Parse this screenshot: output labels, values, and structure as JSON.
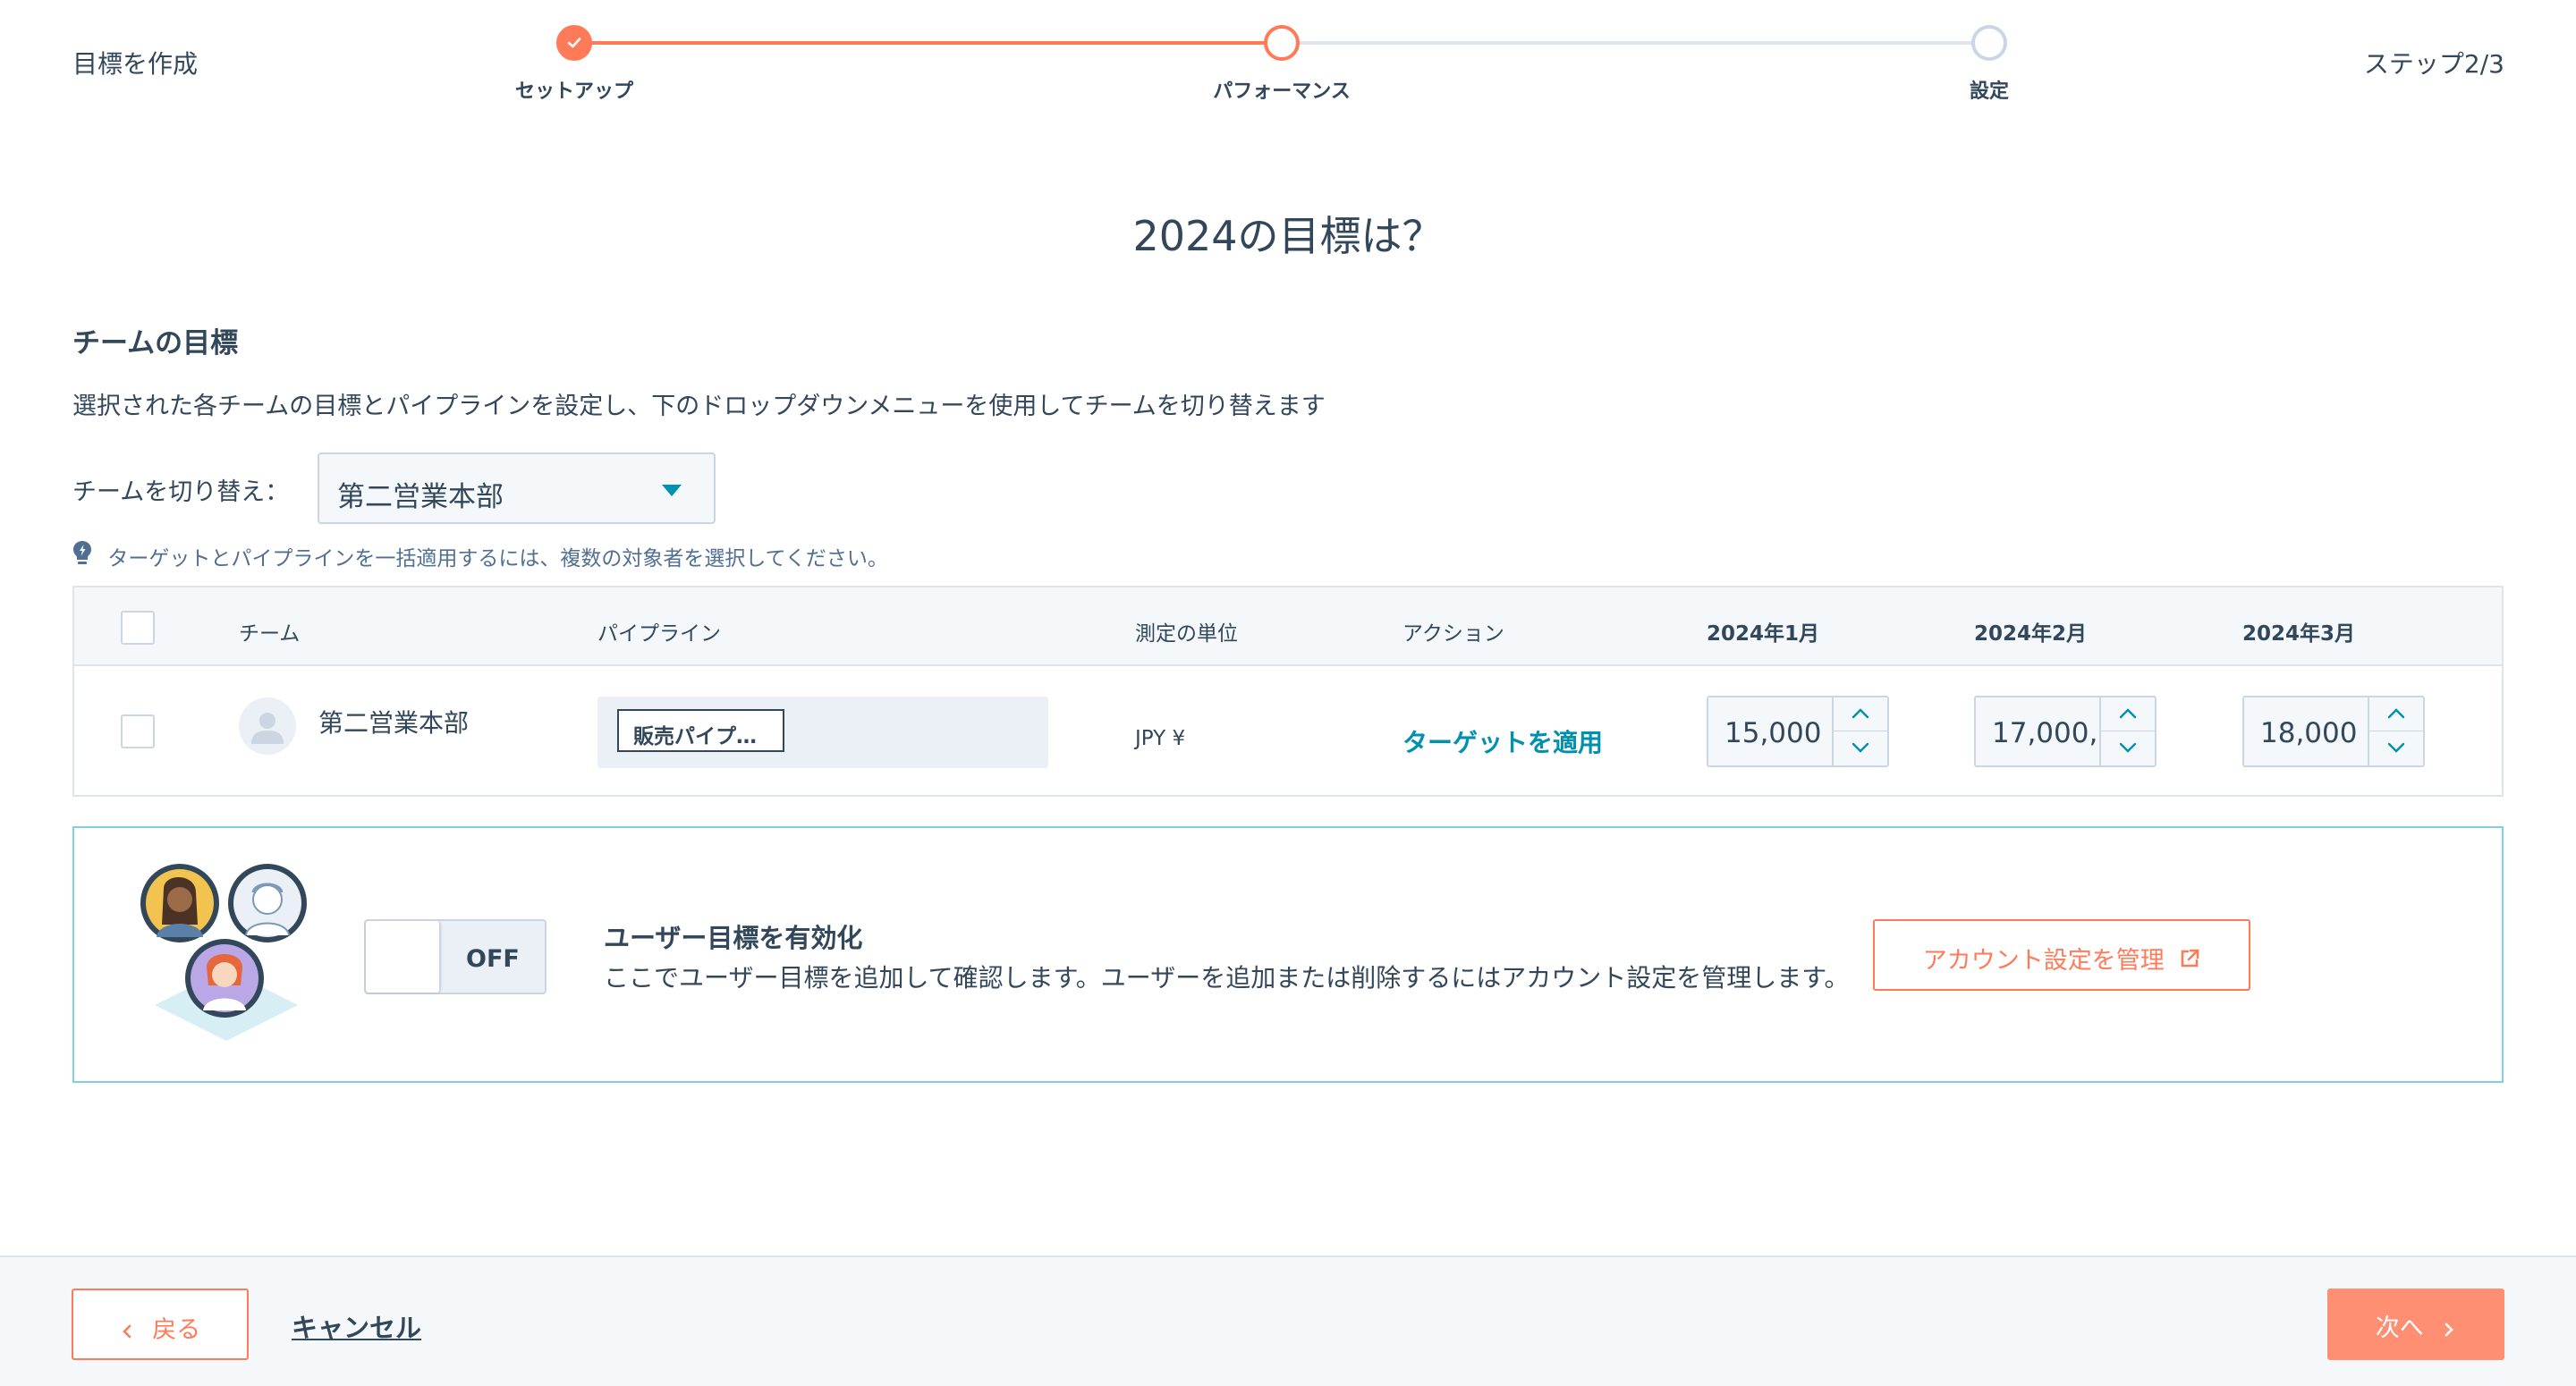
{
  "header": {
    "title": "目標を作成",
    "step_count": "ステップ2/3",
    "steps": [
      {
        "label": "セットアップ",
        "state": "completed"
      },
      {
        "label": "パフォーマンス",
        "state": "active"
      },
      {
        "label": "設定",
        "state": "pending"
      }
    ]
  },
  "main": {
    "page_title": "2024の目標は？",
    "section_title": "チームの目標",
    "section_desc": "選択された各チームの目標とパイプラインを設定し、下のドロップダウンメニューを使用してチームを切り替えます",
    "team_switch_label": "チームを切り替え：",
    "team_select_value": "第二営業本部",
    "hint": "ターゲットとパイプラインを一括適用するには、複数の対象者を選択してください。"
  },
  "table": {
    "columns": [
      "チーム",
      "パイプライン",
      "測定の単位",
      "アクション",
      "2024年1月",
      "2024年2月",
      "2024年3月"
    ],
    "rows": [
      {
        "team": "第二営業本部",
        "pipeline": "販売パイプ…",
        "unit": "JPY ¥",
        "action": "ターゲットを適用",
        "jan": "15,000",
        "feb": "17,000,",
        "mar": "18,000"
      }
    ]
  },
  "user_goals": {
    "toggle_state": "OFF",
    "title": "ユーザー目標を有効化",
    "desc": "ここでユーザー目標を追加して確認します。ユーザーを追加または削除するにはアカウント設定を管理します。",
    "manage_button": "アカウント設定を管理"
  },
  "footer": {
    "back_label": "戻る",
    "cancel_label": "キャンセル",
    "next_label": "次へ"
  },
  "colors": {
    "accent": "#ff7a59",
    "link": "#0091ae",
    "text": "#33475b",
    "border": "#cbd6e2"
  }
}
